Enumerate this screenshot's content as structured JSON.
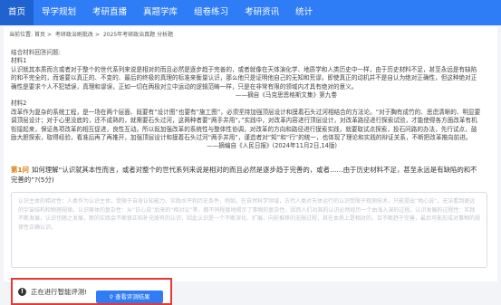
{
  "nav": {
    "items": [
      "首页",
      "导学规划",
      "考研直播",
      "真题学库",
      "组卷练习",
      "考研资讯",
      "统计"
    ]
  },
  "breadcrumb": {
    "prefix": "当前位置:",
    "items": [
      "首页",
      "考研政治刷批改",
      "2025年考研政治真题 分析题"
    ]
  },
  "material": {
    "intro": "结合材料回答问题:",
    "m1_title": "材料1",
    "m1_text": "认识就其本质而言或者对于整个的世代系列来说是相对的而且必然是逐步趋于完善的，或者就像在天体演化学、地质学和人类历史中一样，由于历史材料不足，甚至永远是有缺陷的和不完全的，而谁要以真正的、不变的、最后的终极的真理的标准来衡量认识，那么他只是证明他自己的无知和荒谬。即使真正的动机并不是自认为绝对正确性，但这种绝对正确性是要求个人不犯错误，真理和谬误，正如一切在两极对立中运动的逻辑范畴一样，只是在非常有限的领域内才具有绝对的意义。",
    "m1_source": "——摘自《马克思恩格斯文集》第九卷",
    "m2_title": "材料2",
    "m2_text": "改革作为复杂的系统工程，是一场在两个层面、既要有“设计图”也要有“施工图”，必须坚持加强顶层设计和摸着石头过河相结合的方法论。“对于胸有成竹的、思虑清晰的、明显要调顶层设计；对于心里没底的，还不成熟的，就需要石头过河，这两种者要“两手并用”。”实践中，对改革内容进行顶层设计，对改革路径进行探索试验，才能使得各方面改革有机衔接起来，保证各项改革的相互促进，良性互动。所以既加强改革的系统性与整体性协调，对改革的方向和路径进行摸索实践，就要取试点探索，投石问路的办法，先行试点，鼓励大胆探索，取得经验，看准后再了再推开，加强顶层设计和摸着石头过河“两手并用”，谨造者对“知”和“行”的统一，也体现了理论和实践的辩证关系，不断把改革推向前进。",
    "m2_source": "——摘编自《人民日报》(2024年11月2日,14版)"
  },
  "question": {
    "tag": "第1问",
    "text": "如何理解“认识就其本性而言，或者对整个的世代系列来说是相对的而且必然是逐步趋于完善的，或者……由于历史材料不足，甚至永远是有缺陷的和不完善的”?(5分)"
  },
  "answer": {
    "text": "认识主体的相对性：人类作为认识主体，受限于自身认知能力、实践水平和历史条件，例如，在自然科学领域，古代人类对天体运行的认识受限于观测技术，只能提出“地心说”，无法看到更远的宇宙结构和物理规律。认识客体的复杂性：从“日心说”后来的“相对论”等，都不同程度地揭示了事物的复杂性，因而人们对其的认识必然经历一个由浅入深的过程。认识发展的过程性：实践不断发展，认识也随之发展，新的实践会不断修正和补充原有的认识，因此认识是一个不断深化、扩展、向前推移的无限过程，其在本质上是相对的，且不断趋于完善，最后可能形成对事物的规律性正确认识。"
  },
  "status": {
    "icon": "info-icon",
    "text": "正在进行智能评测!",
    "button_label": "查看评测结果",
    "button_icon": "search-icon"
  },
  "colors": {
    "nav_bg": "#2e7cf6",
    "nav_active": "#1f63d1",
    "accent": "#2e7cf6",
    "highlight_border": "#e53935",
    "question_tag": "#d97706"
  }
}
